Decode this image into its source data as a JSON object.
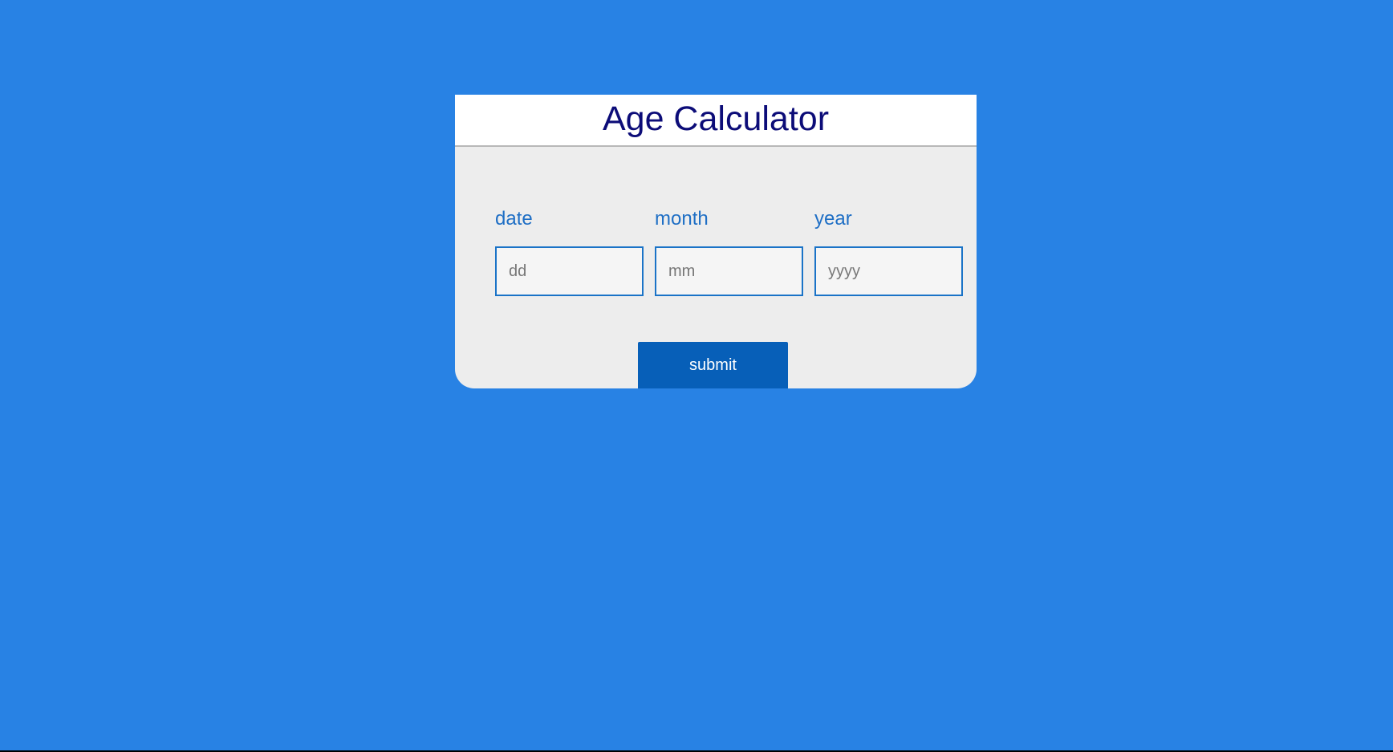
{
  "app": {
    "title": "Age Calculator"
  },
  "form": {
    "fields": [
      {
        "label": "date",
        "placeholder": "dd",
        "value": ""
      },
      {
        "label": "month",
        "placeholder": "mm",
        "value": ""
      },
      {
        "label": "year",
        "placeholder": "yyyy",
        "value": ""
      }
    ],
    "submit_label": "submit"
  },
  "colors": {
    "page_background": "#2882e4",
    "card_background": "#ededed",
    "header_background": "#ffffff",
    "title_color": "#0c0c78",
    "label_color": "#1f6fc5",
    "input_border": "#1a73c7",
    "button_background": "#075fb8",
    "button_text": "#ffffff"
  }
}
